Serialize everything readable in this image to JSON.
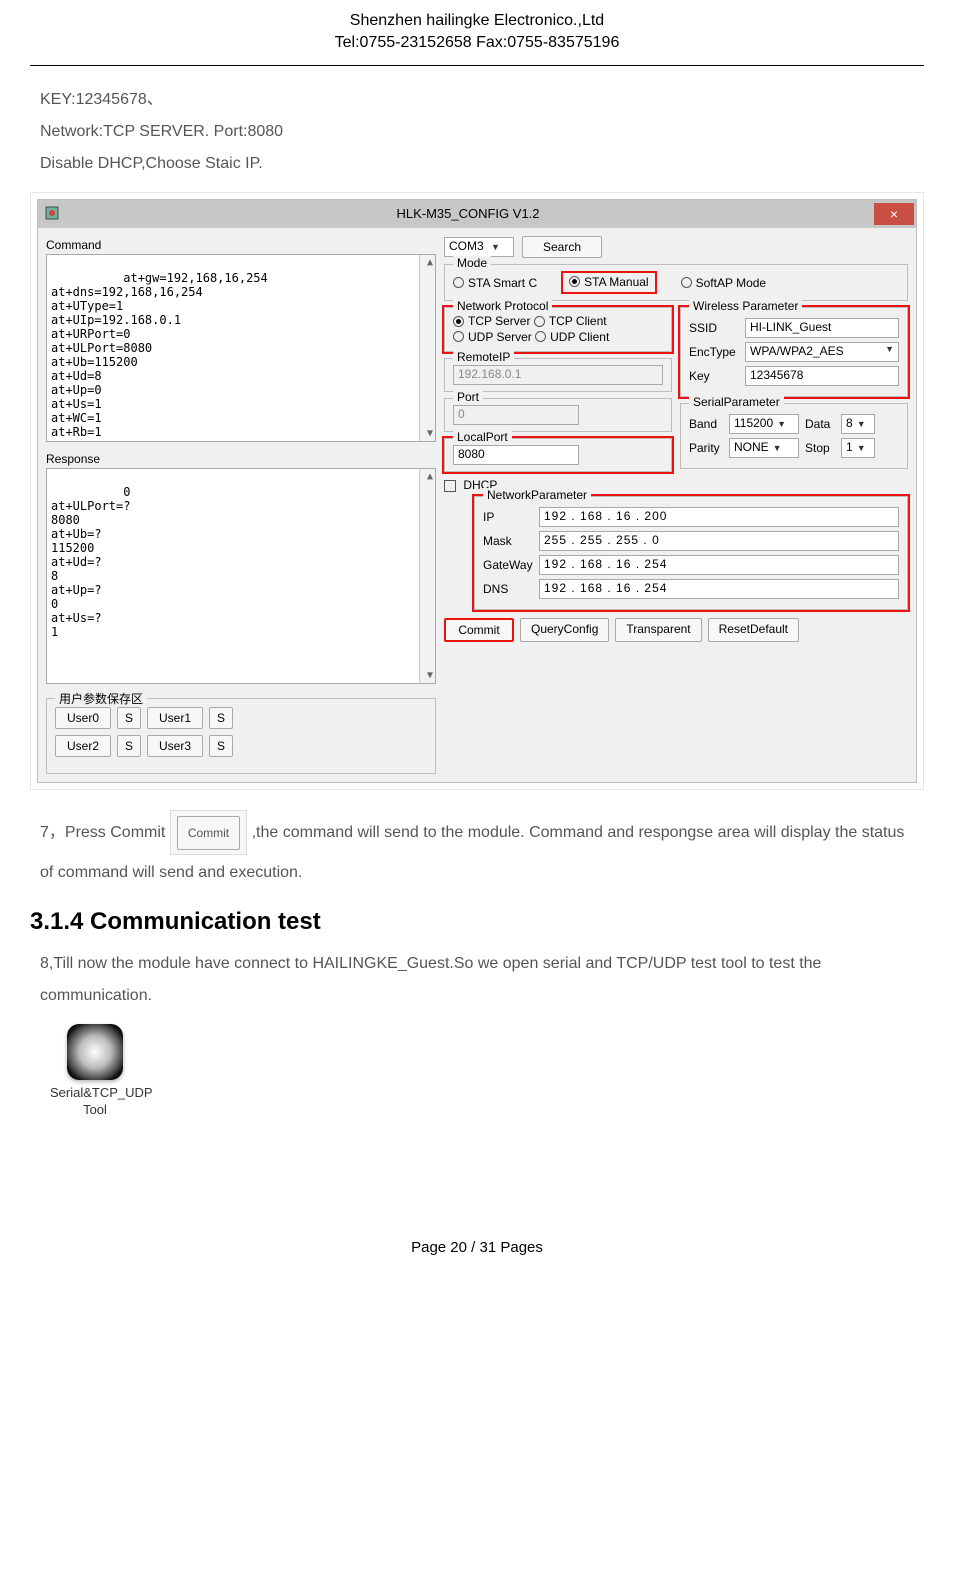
{
  "header": {
    "company": "Shenzhen hailingke Electronico.,Ltd",
    "tel_fax": "Tel:0755-23152658 Fax:0755-83575196"
  },
  "intro": {
    "key_line": "KEY:12345678、",
    "network_line": "Network:TCP SERVER.     Port:8080",
    "dhcp_line": "Disable DHCP,Choose Staic IP."
  },
  "app": {
    "title": "HLK-M35_CONFIG V1.2",
    "close": "×",
    "left": {
      "command_label": "Command",
      "command_text": "at+gw=192,168,16,254\nat+dns=192,168,16,254\nat+UType=1\nat+UIp=192.168.0.1\nat+URPort=0\nat+ULPort=8080\nat+Ub=115200\nat+Ud=8\nat+Up=0\nat+Us=1\nat+WC=1\nat+Rb=1",
      "response_label": "Response",
      "response_text": "0\nat+ULPort=?\n8080\nat+Ub=?\n115200\nat+Ud=?\n8\nat+Up=?\n0\nat+Us=?\n1",
      "user_save_legend": "用户参数保存区",
      "user_buttons": [
        "User0",
        "User1",
        "User2",
        "User3"
      ],
      "s_label": "S"
    },
    "right": {
      "com_port": "COM3",
      "search": "Search",
      "mode_legend": "Mode",
      "modes": {
        "smart": "STA Smart C",
        "manual": "STA Manual",
        "softap": "SoftAP Mode"
      },
      "np_legend": "Network Protocol",
      "protocols": {
        "tcp_server": "TCP Server",
        "tcp_client": "TCP Client",
        "udp_server": "UDP Server",
        "udp_client": "UDP Client"
      },
      "wireless_legend": "Wireless Parameter",
      "wireless": {
        "ssid_label": "SSID",
        "ssid": "HI-LINK_Guest",
        "enc_label": "EncType",
        "enc": "WPA/WPA2_AES",
        "key_label": "Key",
        "key": "12345678"
      },
      "remote_ip_legend": "RemoteIP",
      "remote_ip": "192.168.0.1",
      "port_legend": "Port",
      "port": "0",
      "local_port_legend": "LocalPort",
      "local_port": "8080",
      "serial_legend": "SerialParameter",
      "serial": {
        "band_label": "Band",
        "band": "115200",
        "data_label": "Data",
        "data": "8",
        "parity_label": "Parity",
        "parity": "NONE",
        "stop_label": "Stop",
        "stop": "1"
      },
      "dhcp_label": "DHCP",
      "netparam_legend": "NetworkParameter",
      "netparam": {
        "ip_label": "IP",
        "ip": "192 . 168 .  16  . 200",
        "mask_label": "Mask",
        "mask": "255 . 255 . 255 .   0",
        "gw_label": "GateWay",
        "gw": "192 . 168 .  16  . 254",
        "dns_label": "DNS",
        "dns": "192 . 168 .  16  . 254"
      },
      "commit": "Commit",
      "query": "QueryConfig",
      "transparent": "Transparent",
      "reset": "ResetDefault"
    }
  },
  "step7": {
    "prefix": "7，Press Commit ",
    "commit_btn": "Commit",
    "suffix": " ,the command will send to the module. Command and respongse area will display the status of command will send and execution."
  },
  "section_heading": "3.1.4 Communication test",
  "step8": "8,Till now the module have connect to HAILINGKE_Guest.So we open serial and TCP/UDP test tool to test the communication.",
  "tool_label": "Serial&TCP_UDP Tool",
  "footer": "Page 20 / 31 Pages"
}
